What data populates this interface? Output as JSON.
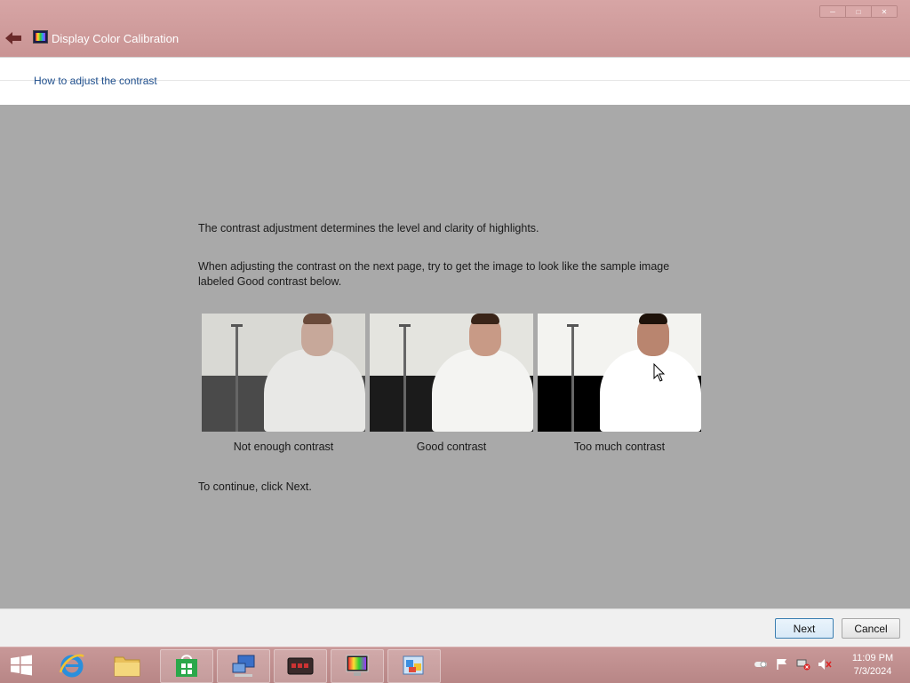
{
  "window": {
    "title": "Display Color Calibration",
    "controls": [
      "minimize",
      "maximize",
      "close"
    ]
  },
  "header": {
    "heading": "How to adjust the contrast"
  },
  "content": {
    "intro": "The contrast adjustment determines the level and clarity of highlights.",
    "instruction": "When adjusting the contrast on the next page, try to get the image to look like the sample image labeled Good contrast below.",
    "samples": [
      {
        "caption": "Not enough contrast"
      },
      {
        "caption": "Good contrast"
      },
      {
        "caption": "Too much contrast"
      }
    ],
    "continue": "To continue, click Next."
  },
  "footer": {
    "next_label": "Next",
    "cancel_label": "Cancel"
  },
  "taskbar": {
    "items": [
      "start-icon",
      "internet-explorer-icon",
      "file-explorer-icon",
      "store-icon",
      "network-icon",
      "media-icon",
      "display-calibration-icon",
      "control-panel-icon"
    ],
    "clock_time": "11:09 PM",
    "clock_date": "7/3/2024"
  },
  "colors": {
    "titlebar": "#c99494",
    "content_bg": "#a9a9a9",
    "link": "#1e4e8c"
  }
}
